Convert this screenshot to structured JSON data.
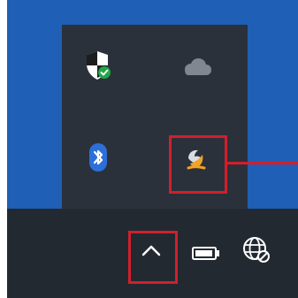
{
  "colors": {
    "desktop": "#1f5fb5",
    "flyout": "#2a313b",
    "taskbar": "#222931",
    "highlight": "#d21f2b",
    "white": "#ffffff",
    "shield_green": "#21a646",
    "cloud_gray": "#7f8891",
    "bluetooth_blue": "#2d6fd8",
    "app_orange": "#f2a224"
  },
  "flyout": {
    "icons": [
      {
        "name": "shield-icon",
        "interactable": true
      },
      {
        "name": "onedrive-cloud-icon",
        "interactable": true
      },
      {
        "name": "bluetooth-icon",
        "interactable": true
      },
      {
        "name": "app-tray-icon",
        "interactable": true,
        "highlighted": true
      }
    ]
  },
  "taskbar": {
    "icons": [
      {
        "name": "show-hidden-icons-chevron-icon",
        "interactable": true,
        "highlighted": true
      },
      {
        "name": "battery-icon",
        "interactable": true
      },
      {
        "name": "network-globe-icon",
        "interactable": true
      }
    ]
  }
}
